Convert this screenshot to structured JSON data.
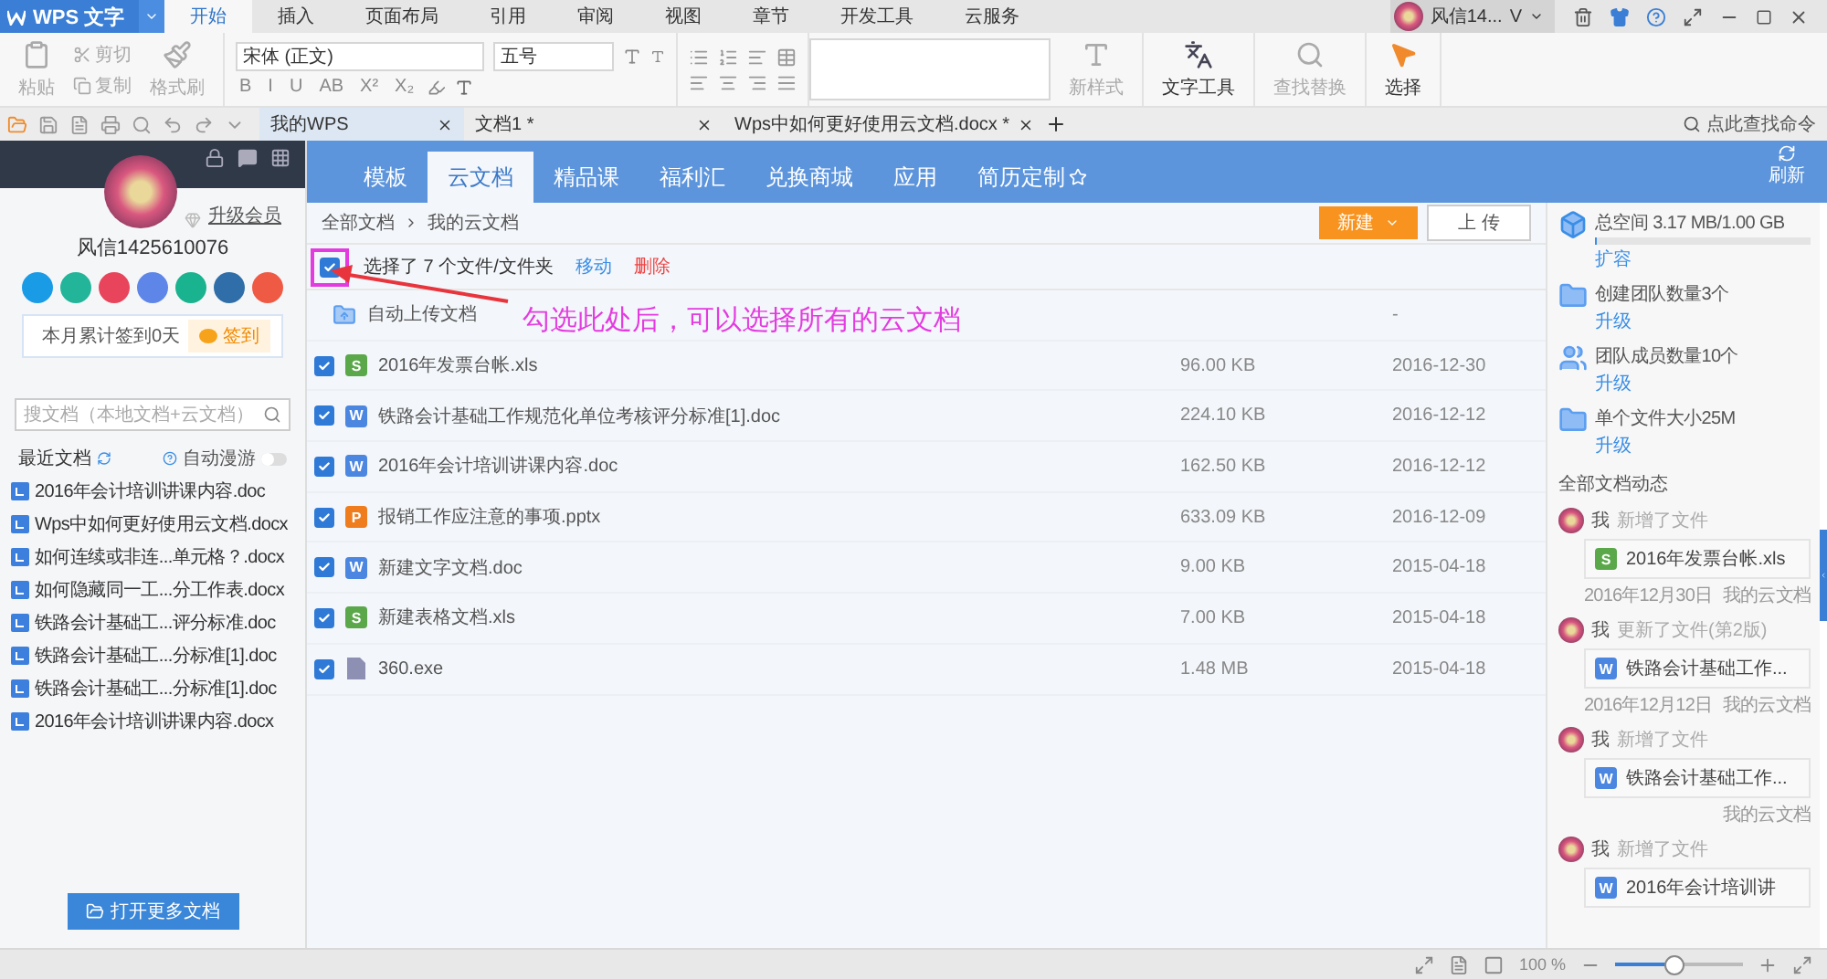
{
  "titlebar": {
    "app": "WPS 文字",
    "tabs": [
      {
        "label": "开始",
        "selected": true
      },
      {
        "label": "插入",
        "selected": false
      },
      {
        "label": "页面布局",
        "selected": false
      },
      {
        "label": "引用",
        "selected": false
      },
      {
        "label": "审阅",
        "selected": false
      },
      {
        "label": "视图",
        "selected": false
      },
      {
        "label": "章节",
        "selected": false
      },
      {
        "label": "开发工具",
        "selected": false
      },
      {
        "label": "云服务",
        "selected": false
      }
    ],
    "user": "风信14...",
    "vip": "V"
  },
  "ribbon": {
    "clipboard": [
      {
        "label": "粘贴",
        "disabled": true
      },
      {
        "label": "剪切",
        "disabled": true
      },
      {
        "label": "复制",
        "disabled": true
      },
      {
        "label": "格式刷",
        "disabled": true
      }
    ],
    "font": "宋体 (正文)",
    "size": "五号",
    "format_buttons": [
      "B",
      "I",
      "U",
      "AB",
      "X²",
      "X₂"
    ],
    "big_buttons": [
      {
        "kind": "style",
        "label": "新样式",
        "disabled": true
      },
      {
        "kind": "text",
        "label": "文字工具",
        "disabled": false
      },
      {
        "kind": "find",
        "label": "查找替换",
        "disabled": true
      },
      {
        "kind": "select",
        "label": "选择",
        "disabled": false
      }
    ]
  },
  "doc_tabs": [
    {
      "label": "我的WPS",
      "selected": true
    },
    {
      "label": "文档1 *",
      "selected": false
    },
    {
      "label": "Wps中如何更好使用云文档.docx *",
      "selected": false
    }
  ],
  "command_search": {
    "placeholder": "点此查找命令"
  },
  "left_panel": {
    "username": "风信1425610076",
    "upgrade": "升级会员",
    "shortcuts": [
      {
        "color": "#1a9be6"
      },
      {
        "color": "#22b59a"
      },
      {
        "color": "#e8455c"
      },
      {
        "color": "#5d86e8"
      },
      {
        "color": "#1ab38f"
      },
      {
        "color": "#2f6ea8"
      },
      {
        "color": "#ef5a45"
      }
    ],
    "checkin": {
      "text": "本月累计签到0天",
      "button": "签到"
    },
    "search": {
      "placeholder": "搜文档（本地文档+云文档）"
    },
    "recent_title": "最近文档",
    "auto_roam": {
      "label": "自动漫游",
      "on": false
    },
    "recent": [
      "2016年会计培训讲课内容.doc",
      "Wps中如何更好使用云文档.docx",
      "如何连续或非连...单元格？.docx",
      "如何隐藏同一工...分工作表.docx",
      "铁路会计基础工...评分标准.doc",
      "铁路会计基础工...分标准[1].doc",
      "铁路会计基础工...分标准[1].doc",
      "2016年会计培训讲课内容.docx"
    ],
    "open_more": "打开更多文档"
  },
  "nav_tabs": [
    {
      "label": "模板",
      "selected": false
    },
    {
      "label": "云文档",
      "selected": true
    },
    {
      "label": "精品课",
      "selected": false
    },
    {
      "label": "福利汇",
      "selected": false
    },
    {
      "label": "兑换商城",
      "selected": false
    },
    {
      "label": "应用",
      "selected": false
    },
    {
      "label": "简历定制",
      "selected": false
    }
  ],
  "refresh": "刷新",
  "breadcrumb": [
    "全部文档",
    "我的云文档"
  ],
  "new_button": "新建",
  "upload_button": "上 传",
  "selection": {
    "checked": true,
    "text": "选择了 7 个文件/文件夹",
    "move": "移动",
    "delete": "删除"
  },
  "annotation": "勾选此处后，可以选择所有的云文档",
  "folder": {
    "name": "自动上传文档",
    "date": "-"
  },
  "files": [
    {
      "kind": "sheet",
      "letter": "S",
      "name": "2016年发票台帐.xls",
      "size": "96.00 KB",
      "date": "2016-12-30",
      "checked": true
    },
    {
      "kind": "doc",
      "letter": "W",
      "name": "铁路会计基础工作规范化单位考核评分标准[1].doc",
      "size": "224.10 KB",
      "date": "2016-12-12",
      "checked": true
    },
    {
      "kind": "doc",
      "letter": "W",
      "name": "2016年会计培训讲课内容.doc",
      "size": "162.50 KB",
      "date": "2016-12-12",
      "checked": true
    },
    {
      "kind": "slide",
      "letter": "P",
      "name": "报销工作应注意的事项.pptx",
      "size": "633.09 KB",
      "date": "2016-12-09",
      "checked": true
    },
    {
      "kind": "doc",
      "letter": "W",
      "name": "新建文字文档.doc",
      "size": "9.00 KB",
      "date": "2015-04-18",
      "checked": true
    },
    {
      "kind": "sheet",
      "letter": "S",
      "name": "新建表格文档.xls",
      "size": "7.00 KB",
      "date": "2015-04-18",
      "checked": true
    },
    {
      "kind": "file",
      "name": "360.exe",
      "size": "1.48 MB",
      "date": "2015-04-18",
      "checked": true
    }
  ],
  "right_panel": {
    "storage": {
      "text": "总空间 3.17 MB/1.00 GB",
      "level": 0.01,
      "link": "扩容"
    },
    "quotas": [
      {
        "kind": "team",
        "text": "创建团队数量3个",
        "link": "升级"
      },
      {
        "kind": "members",
        "text": "团队成员数量10个",
        "link": "升级"
      },
      {
        "kind": "size",
        "text": "单个文件大小25M",
        "link": "升级"
      }
    ],
    "feed_title": "全部文档动态",
    "feed": [
      {
        "actor": "我",
        "action": "新增了文件",
        "kind": "sheet",
        "letter": "S",
        "file": "2016年发票台帐.xls",
        "date": "2016年12月30日",
        "place": "我的云文档"
      },
      {
        "actor": "我",
        "action": "更新了文件(第2版)",
        "kind": "doc",
        "letter": "W",
        "file": "铁路会计基础工作...",
        "date": "2016年12月12日",
        "place": "我的云文档"
      },
      {
        "actor": "我",
        "action": "新增了文件",
        "kind": "doc",
        "letter": "W",
        "file": "铁路会计基础工作...",
        "place": "我的云文档"
      },
      {
        "actor": "我",
        "action": "新增了文件",
        "kind": "doc",
        "letter": "W",
        "file": "2016年会计培训讲"
      }
    ]
  },
  "status_bar": {
    "zoom": "100 %",
    "level": 0.45
  }
}
